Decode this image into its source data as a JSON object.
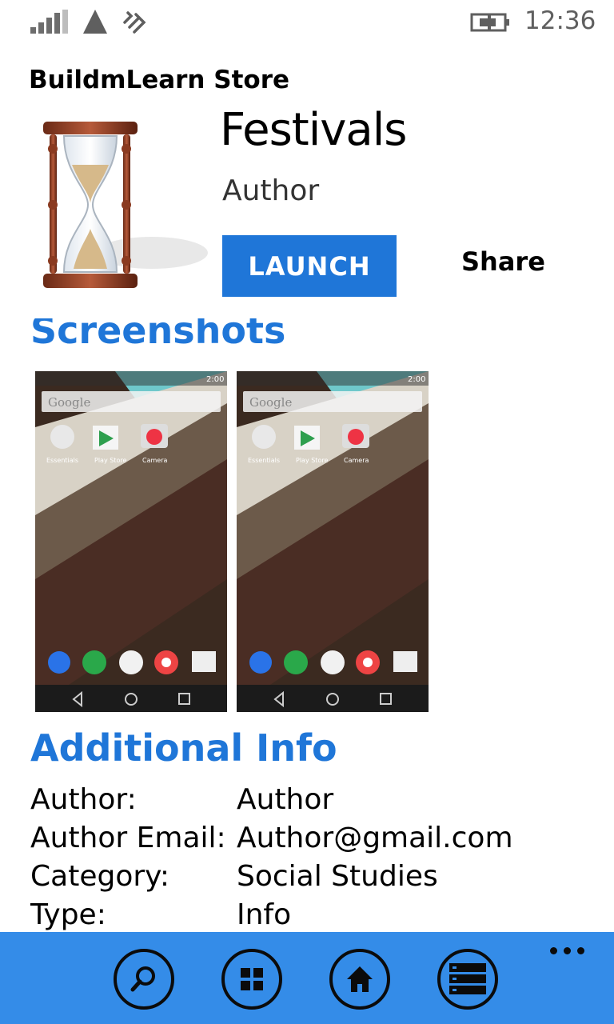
{
  "status_bar": {
    "time": "12:36",
    "icons": [
      "signal-icon",
      "triangle-icon",
      "wifi-icon",
      "battery-icon"
    ]
  },
  "header": {
    "app_title": "BuildmLearn Store"
  },
  "app": {
    "name": "Festivals",
    "author": "Author",
    "icon": "hourglass-icon",
    "launch_label": "LAUNCH",
    "share_label": "Share"
  },
  "screenshots": {
    "title": "Screenshots",
    "items": [
      {
        "search_label": "Google",
        "time": "2:00",
        "apps": [
          "Essentials",
          "Play Store",
          "Camera"
        ]
      },
      {
        "search_label": "Google",
        "time": "2:00",
        "apps": [
          "Essentials",
          "Play Store",
          "Camera"
        ]
      }
    ]
  },
  "additional_info": {
    "title": "Additional Info",
    "rows": [
      {
        "label": "Author:",
        "value": "Author"
      },
      {
        "label": "Author Email:",
        "value": "Author@gmail.com"
      },
      {
        "label": "Category:",
        "value": "Social Studies"
      },
      {
        "label": "Type:",
        "value": "Info"
      }
    ]
  },
  "app_bar": {
    "buttons": [
      "search-icon",
      "grid-icon",
      "home-icon",
      "list-icon"
    ],
    "more_icon": "more-icon"
  },
  "colors": {
    "accent": "#1f76d8",
    "app_bar": "#348ce8"
  }
}
